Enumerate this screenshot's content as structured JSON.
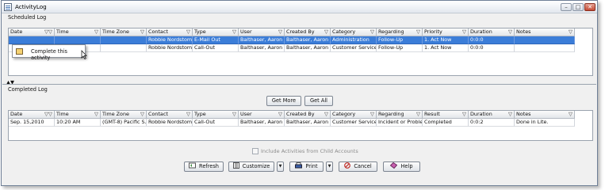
{
  "window": {
    "title": "ActivityLog",
    "minimize_glyph": "–",
    "maximize_glyph": "□",
    "close_glyph": "✕"
  },
  "scheduled": {
    "label": "Scheduled Log",
    "columns": [
      "Date",
      "Time",
      "Time Zone",
      "Contact",
      "Type",
      "User",
      "Created By",
      "Category",
      "Regarding",
      "Priority",
      "Duration",
      "Notes"
    ],
    "rows": [
      [
        "",
        "",
        "",
        "Robbie Nordstome",
        "E-Mail Out",
        "Balthaser, Aaron",
        "Balthaser, Aaron",
        "Administration",
        "Follow-Up",
        "1. Act Now",
        "0:0:0",
        ""
      ],
      [
        "",
        "",
        "",
        "Robbie Nordstome",
        "Call-Out",
        "Balthaser, Aaron",
        "Balthaser, Aaron",
        "Customer Service",
        "Follow-Up",
        "1. Act Now",
        "0:0:0",
        ""
      ]
    ]
  },
  "context_menu": {
    "item": "Complete this activity"
  },
  "completed": {
    "label": "Completed Log",
    "get_more": "Get More",
    "get_all": "Get All",
    "columns": [
      "Date",
      "Time",
      "Time Zone",
      "Contact",
      "Type",
      "User",
      "Created By",
      "Category",
      "Regarding",
      "Result",
      "Duration",
      "Notes"
    ],
    "rows": [
      [
        "Sep. 15,2010",
        "10:20 AM",
        "(GMT-8) Pacific S...",
        "Robbie Nordstome",
        "Call-Out",
        "Balthaser, Aaron",
        "Balthaser, Aaron",
        "Customer Service",
        "Incident or Problem",
        "Completed",
        "0:0:2",
        "Done in Lite."
      ]
    ]
  },
  "include_children": "Include Activities from Child Accounts",
  "buttons": {
    "refresh": "Refresh",
    "customize": "Customize",
    "print": "Print",
    "cancel": "Cancel",
    "help": "Help"
  },
  "filter_glyph": "▽",
  "sort_glyph": "▽▽",
  "splitter_glyph": "▲▼",
  "dropdown_glyph": "▼",
  "icons": {
    "refresh": "refresh-icon",
    "customize": "customize-icon",
    "print": "printer-icon",
    "cancel": "cancel-icon",
    "help": "help-icon",
    "filter": "filter-icon"
  },
  "colors": {
    "selection": "#3b7dd8",
    "window_border": "#6e7f96",
    "close_button": "#c44a35"
  }
}
